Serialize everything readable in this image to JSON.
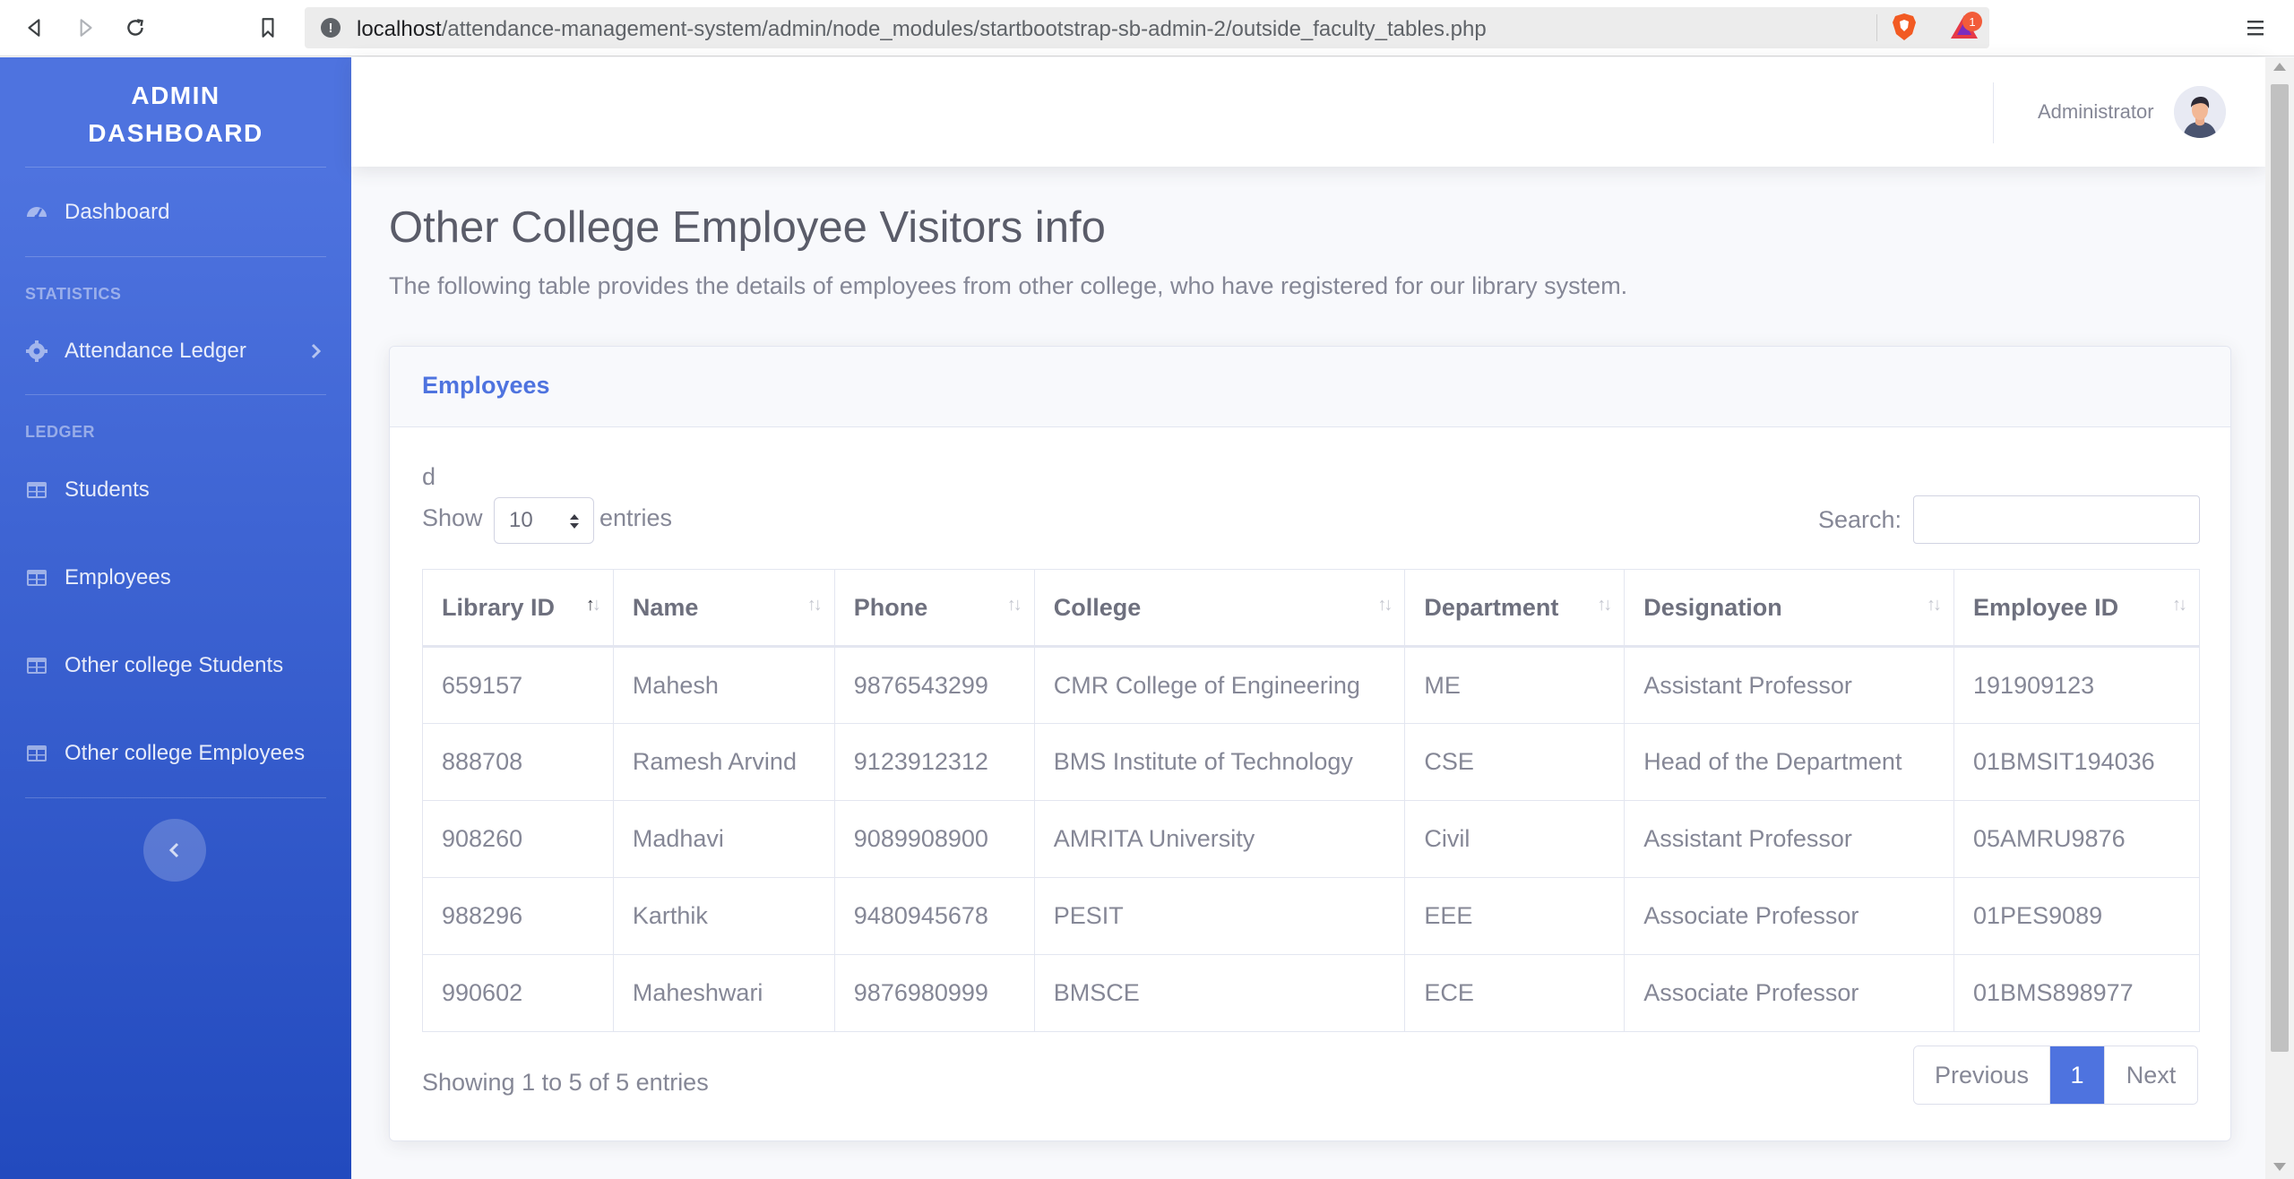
{
  "browser": {
    "url_host": "localhost",
    "url_path": "/attendance-management-system/admin/node_modules/startbootstrap-sb-admin-2/outside_faculty_tables.php",
    "badge_count": "1"
  },
  "sidebar": {
    "brand_line1": "ADMIN",
    "brand_line2": "DASHBOARD",
    "dashboard": "Dashboard",
    "heading_statistics": "STATISTICS",
    "attendance_ledger": "Attendance Ledger",
    "heading_ledger": "LEDGER",
    "items": [
      "Students",
      "Employees",
      "Other college Students",
      "Other college Employees"
    ]
  },
  "topbar": {
    "user": "Administrator"
  },
  "page": {
    "title": "Other College Employee Visitors info",
    "description": "The following table provides the details of employees from other college, who have registered for our library system."
  },
  "card": {
    "title": "Employees",
    "stray_text": "d",
    "show_label": "Show",
    "page_length": "10",
    "entries_label": "entries",
    "search_label": "Search:",
    "columns": [
      "Library ID",
      "Name",
      "Phone",
      "College",
      "Department",
      "Designation",
      "Employee ID"
    ],
    "rows": [
      [
        "659157",
        "Mahesh",
        "9876543299",
        "CMR College of Engineering",
        "ME",
        "Assistant Professor",
        "191909123"
      ],
      [
        "888708",
        "Ramesh Arvind",
        "9123912312",
        "BMS Institute of Technology",
        "CSE",
        "Head of the Department",
        "01BMSIT194036"
      ],
      [
        "908260",
        "Madhavi",
        "9089908900",
        "AMRITA University",
        "Civil",
        "Assistant Professor",
        "05AMRU9876"
      ],
      [
        "988296",
        "Karthik",
        "9480945678",
        "PESIT",
        "EEE",
        "Associate Professor",
        "01PES9089"
      ],
      [
        "990602",
        "Maheshwari",
        "9876980999",
        "BMSCE",
        "ECE",
        "Associate Professor",
        "01BMS898977"
      ]
    ],
    "info": "Showing 1 to 5 of 5 entries",
    "pager": {
      "previous": "Previous",
      "current": "1",
      "next": "Next"
    }
  },
  "colors": {
    "primary": "#4e73df",
    "sidebar_bottom": "#224abe",
    "text": "#858796"
  },
  "icons": {
    "dashboard": "tachometer-icon",
    "attendance": "cog-icon",
    "tables": "table-icon",
    "collapse": "chevron-left-icon"
  }
}
